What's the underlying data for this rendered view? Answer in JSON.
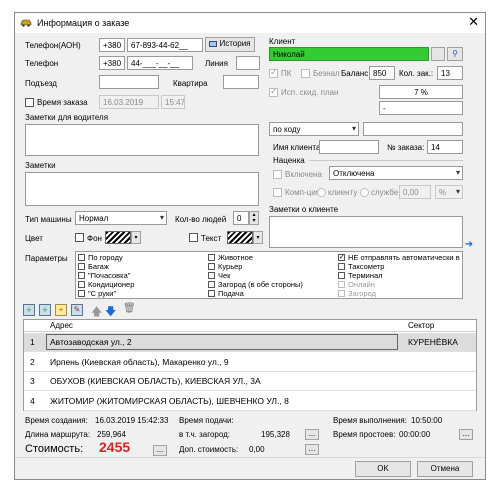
{
  "window": {
    "title": "Информация о заказе"
  },
  "left": {
    "phone_aon_label": "Телефон(АОН)",
    "phone_aon_code": "+380",
    "phone_aon_number": "67-893-44-62__",
    "history_button": "История",
    "phone_label": "Телефон",
    "phone_code": "+380",
    "phone_number": "44-___-__-__",
    "line_label": "Линия",
    "entrance_label": "Подъезд",
    "apartment_label": "Квартира",
    "order_time_label": "Время заказа",
    "order_date": "16.03.2019",
    "order_time": "15:47",
    "driver_notes_label": "Заметки для водителя",
    "notes_label": "Заметки",
    "car_type_label": "Тип машины",
    "car_type_value": "Нормал",
    "people_count_label": "Кол-во людей",
    "people_count_value": "0",
    "color_label": "Цвет",
    "background_label": "Фон",
    "text_label": "Текст"
  },
  "right": {
    "client_label": "Клиент",
    "client_name": "Николай",
    "pk_label": "ПК",
    "cashless_label": "Безнал",
    "balance_label": "Баланс:",
    "balance_value": "850",
    "orders_count_label": "Кол. зак.:",
    "orders_count_value": "13",
    "discount_plan_label": "Исп. скид. план",
    "discount_percent": "7 %",
    "discount_extra": "-",
    "by_code_value": "по коду",
    "client_name_label": "Имя клиента",
    "order_num_label": "№ заказа:",
    "order_num_value": "14",
    "markup_group": "Наценка",
    "markup_enabled_label": "Включена",
    "markup_value": "Отключена",
    "commission_label": "Комп-ция",
    "to_client_label": "клиенту",
    "to_service_label": "службе",
    "commission_value": "0,00",
    "commission_unit": "%",
    "client_notes_label": "Заметки о клиенте"
  },
  "params": {
    "label": "Параметры",
    "col1": [
      "По городу",
      "Багаж",
      "\"Почасовка\"",
      "Кондиционер",
      "\"С руки\""
    ],
    "col2": [
      "Животное",
      "Курьер",
      "Чек",
      "Загород (в обе стороны)",
      "Подача"
    ],
    "col3": [
      "НЕ отправлять автоматически в",
      "Таксометр",
      "Терминал",
      "Онлайн",
      "Загород"
    ]
  },
  "route": {
    "col_address": "Адрес",
    "col_sector": "Сектор",
    "rows": [
      {
        "num": "1",
        "address": "Автозаводская ул., 2",
        "sector": "КУРЕНЁВКА"
      },
      {
        "num": "2",
        "address": "Ирпень (Киевская область), Макаренко ул., 9",
        "sector": ""
      },
      {
        "num": "3",
        "address": "ОБУХОВ (КИЕВСКАЯ ОБЛАСТЬ), КИЕВСКАЯ УЛ., 3А",
        "sector": ""
      },
      {
        "num": "4",
        "address": "ЖИТОМИР (ЖИТОМИРСКАЯ ОБЛАСТЬ), ШЕВЧЕНКО УЛ., 8",
        "sector": ""
      }
    ]
  },
  "summary": {
    "created_label": "Время создания:",
    "created_value": "16.03.2019 15:42:33",
    "route_len_label": "Длина маршрута:",
    "route_len_value": "259,964",
    "cost_label": "Стоимость:",
    "cost_value": "2455",
    "arrival_label": "Время подачи:",
    "outside_label": "в т.ч. загород:",
    "outside_value": "195,328",
    "extra_cost_label": "Доп. стоимость:",
    "extra_cost_value": "0,00",
    "exec_time_label": "Время выполнения:",
    "exec_time_value": "10:50:00",
    "idle_label": "Время простоев:",
    "idle_value": "00:00:00",
    "dots": "..."
  },
  "buttons": {
    "ok": "OK",
    "cancel": "Отмена"
  },
  "colors": {
    "client_field": "#33cc33",
    "cost": "#e02020",
    "selected_row": "#dcdcdc"
  },
  "icons": [
    "car-icon",
    "close-icon",
    "history-icon",
    "client-search-icon",
    "arrow-right-icon",
    "add-icon",
    "arrow-up-icon",
    "arrow-down-icon",
    "delete-icon"
  ]
}
